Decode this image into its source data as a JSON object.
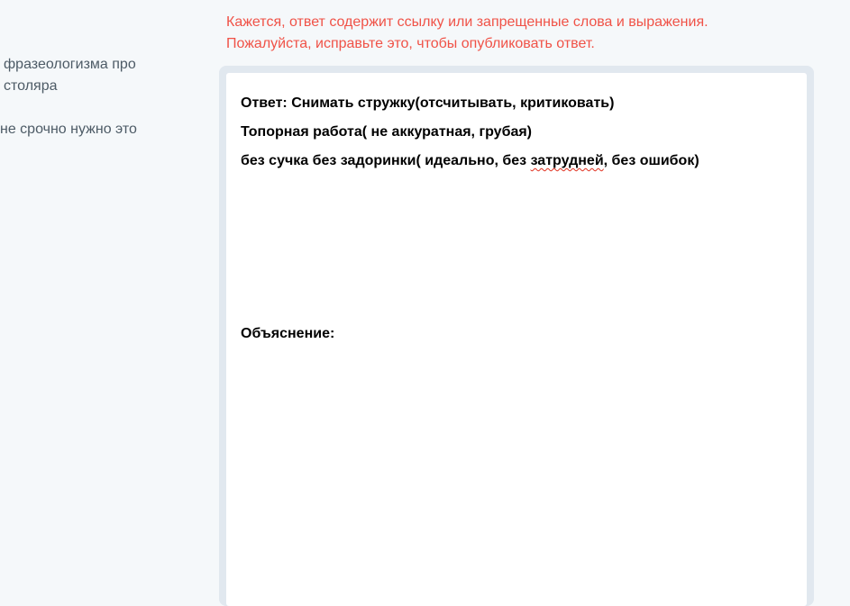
{
  "question": {
    "line1": "фразеологизма про",
    "line2": "столяра",
    "line3": "не срочно нужно это"
  },
  "warning": {
    "line1": "Кажется, ответ содержит ссылку или запрещенные слова и выражения.",
    "line2": "Пожалуйста, исправьте это, чтобы опубликовать ответ."
  },
  "editor": {
    "line1": "Ответ: Снимать стружку(отсчитывать, критиковать)",
    "line2": "Топорная работа( не аккуратная, грубая)",
    "line3_before": "без сучка без задоринки( идеально, без ",
    "line3_misspelled": "затрудней",
    "line3_after": ", без ошибок)",
    "explanation_label": "Объяснение:"
  },
  "colors": {
    "warning": "#f05247",
    "frame": "#e1e8ef",
    "background": "#f5f8fa",
    "question_text": "#4d5b66"
  }
}
